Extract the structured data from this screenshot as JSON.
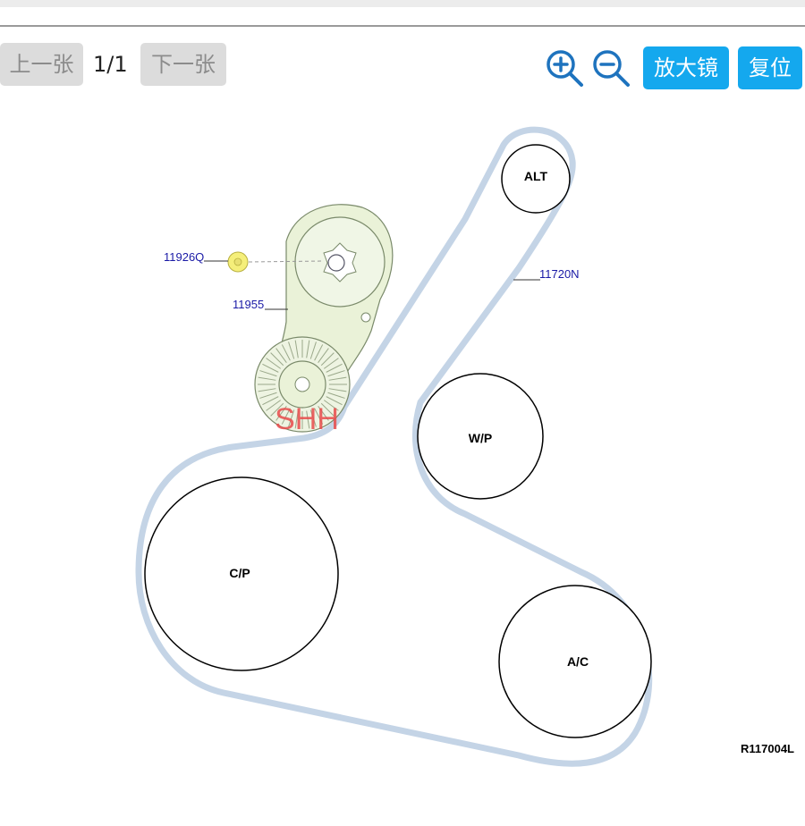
{
  "toolbar": {
    "prev_label": "上一张",
    "page_indicator": "1/1",
    "next_label": "下一张",
    "zoom_in_icon": "zoom-in-icon",
    "zoom_out_icon": "zoom-out-icon",
    "magnifier_label": "放大镜",
    "reset_label": "复位",
    "accent_color": "#14a8ee"
  },
  "diagram": {
    "pulleys": {
      "alt": "ALT",
      "wp": "W/P",
      "cp": "C/P",
      "ac": "A/C"
    },
    "callouts": {
      "bolt": "11926Q",
      "tensioner": "11955",
      "belt": "11720N"
    },
    "watermark": "SHH",
    "figure_id": "R117004L",
    "belt_color": "#c4d4e6",
    "tensioner_color": "#eaf2d8",
    "callout_color": "#1a1aa6"
  }
}
